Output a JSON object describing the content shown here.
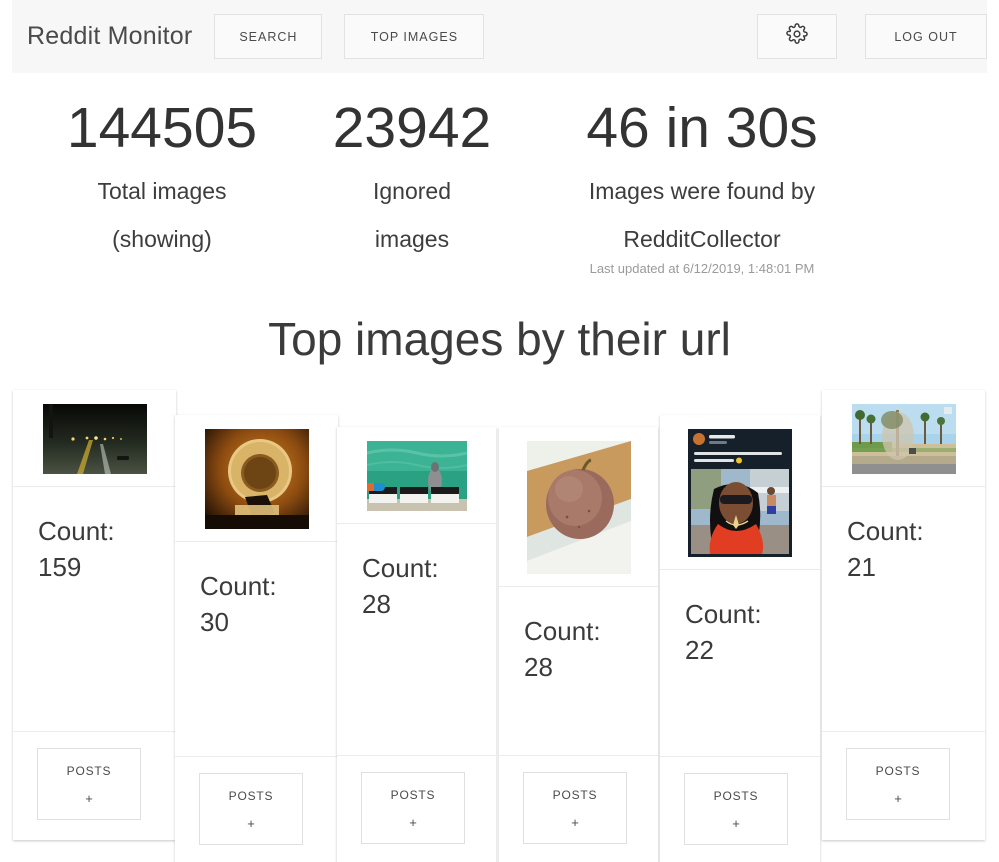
{
  "toolbar": {
    "brand": "Reddit Monitor",
    "search_label": "SEARCH",
    "top_images_label": "TOP IMAGES",
    "settings_icon": "gear-icon",
    "logout_label": "LOG OUT"
  },
  "stats": [
    {
      "value": "144505",
      "label": "Total images",
      "label2": "(showing)",
      "sub": ""
    },
    {
      "value": "23942",
      "label": "Ignored",
      "label2": "images",
      "sub": ""
    },
    {
      "value": "46 in 30s",
      "label": "Images were found by",
      "label2": "RedditCollector",
      "sub": "Last updated at 6/12/2019, 1:48:01 PM"
    }
  ],
  "section": {
    "title": "Top images by their url"
  },
  "cards": {
    "count_label": "Count:",
    "posts_label": "POSTS",
    "expand_glyph": "+",
    "items": [
      {
        "count": "159",
        "image_name": "night-road-thumbnail"
      },
      {
        "count": "30",
        "image_name": "brass-ring-on-wood-thumbnail"
      },
      {
        "count": "28",
        "image_name": "recycling-bins-by-water-thumbnail"
      },
      {
        "count": "28",
        "image_name": "brown-apple-on-ledge-thumbnail"
      },
      {
        "count": "22",
        "image_name": "social-post-woman-red-top-thumbnail"
      },
      {
        "count": "21",
        "image_name": "park-palm-trees-thumbnail"
      }
    ]
  },
  "colors": {
    "toolbar_bg": "#f7f7f7",
    "page_bg": "#ffffff",
    "text": "#3b3b3b",
    "muted": "#9a9a9a",
    "border": "#e2e2e2"
  }
}
